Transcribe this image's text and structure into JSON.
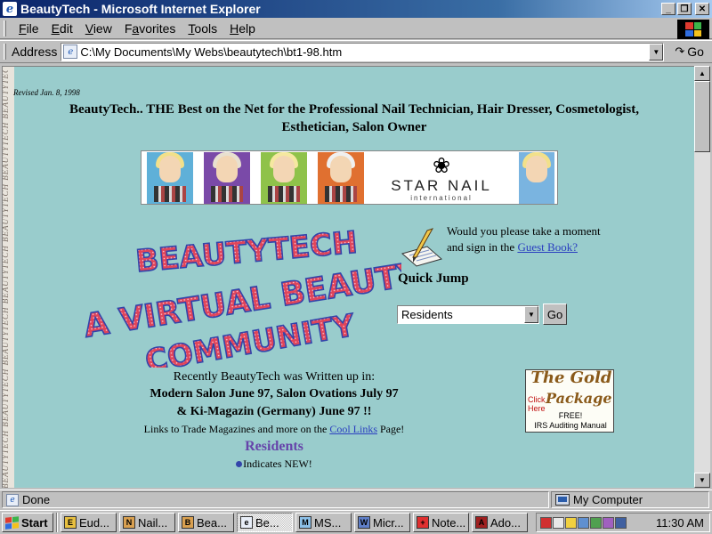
{
  "window": {
    "title": "BeautyTech - Microsoft Internet Explorer",
    "controls": {
      "minimize": "_",
      "maximize": "❐",
      "close": "✕"
    }
  },
  "menu": [
    "File",
    "Edit",
    "View",
    "Favorites",
    "Tools",
    "Help"
  ],
  "menu_mnemonic": [
    "F",
    "E",
    "V",
    "a",
    "T",
    "H"
  ],
  "address": {
    "label": "Address",
    "url": "C:\\My Documents\\My Webs\\beautytech\\bt1-98.htm",
    "go_label": "Go"
  },
  "page": {
    "side_strip_text": "BEAUTYTECH  BEAUTYTECH  BEAUTYTECH  BEAUTYTECH  BEAUTYTECH  BEAUTYTECH  BEAUTYTECH",
    "revised": "Revised Jan. 8, 1998",
    "headline": "BeautyTech.. THE Best on the Net for the Professional Nail Technician, Hair Dresser, Cosmetologist, Esthetician, Salon Owner",
    "banner": {
      "brand": "STAR NAIL",
      "sub": "international"
    },
    "wordart_lines": [
      "BEAUTYTECH",
      "A VIRTUAL BEAUTY",
      "COMMUNITY"
    ],
    "guestbook": {
      "line1": "Would you please take a moment",
      "line2_prefix": "and sign in the ",
      "link": "Guest Book?"
    },
    "quick_jump": {
      "label": "Quick Jump",
      "selected": "Residents",
      "go_label": "Go"
    },
    "writeup": {
      "line1": "Recently BeautyTech was Written up in:",
      "line2": "Modern Salon June 97, Salon Ovations July 97",
      "line3": "& Ki-Magazin (Germany) June 97 !!",
      "line4_prefix": "Links to Trade Magazines and more on the ",
      "line4_link": "Cool Links",
      "line4_suffix": " Page!",
      "residents": "Residents",
      "new_note": "Indicates NEW!"
    },
    "gold_package": {
      "title": "The Gold",
      "package": "Package",
      "click_here": "Click Here",
      "free": "FREE!",
      "irs": "IRS Auditing Manual"
    }
  },
  "status": {
    "text": "Done",
    "zone": "My Computer"
  },
  "taskbar": {
    "start": "Start",
    "tasks": [
      {
        "label": "Eud...",
        "icon": "E",
        "color": "#e8c040",
        "active": false
      },
      {
        "label": "Nail...",
        "icon": "N",
        "color": "#d9a050",
        "active": false
      },
      {
        "label": "Bea...",
        "icon": "B",
        "color": "#d9a050",
        "active": false
      },
      {
        "label": "Be...",
        "icon": "e",
        "color": "#e8eef8",
        "active": true
      },
      {
        "label": "MS...",
        "icon": "M",
        "color": "#8cc0e8",
        "active": false
      },
      {
        "label": "Micr...",
        "icon": "W",
        "color": "#5f7fc8",
        "active": false
      },
      {
        "label": "Note...",
        "icon": "+",
        "color": "#e03030",
        "active": false
      },
      {
        "label": "Ado...",
        "icon": "A",
        "color": "#a02020",
        "active": false
      }
    ],
    "clock": "11:30 AM"
  },
  "colors": {
    "content_bg": "#99cccc",
    "link": "#2a3ec0",
    "wordart_fill": "#e0455a",
    "wordart_outline": "#3344aa"
  }
}
